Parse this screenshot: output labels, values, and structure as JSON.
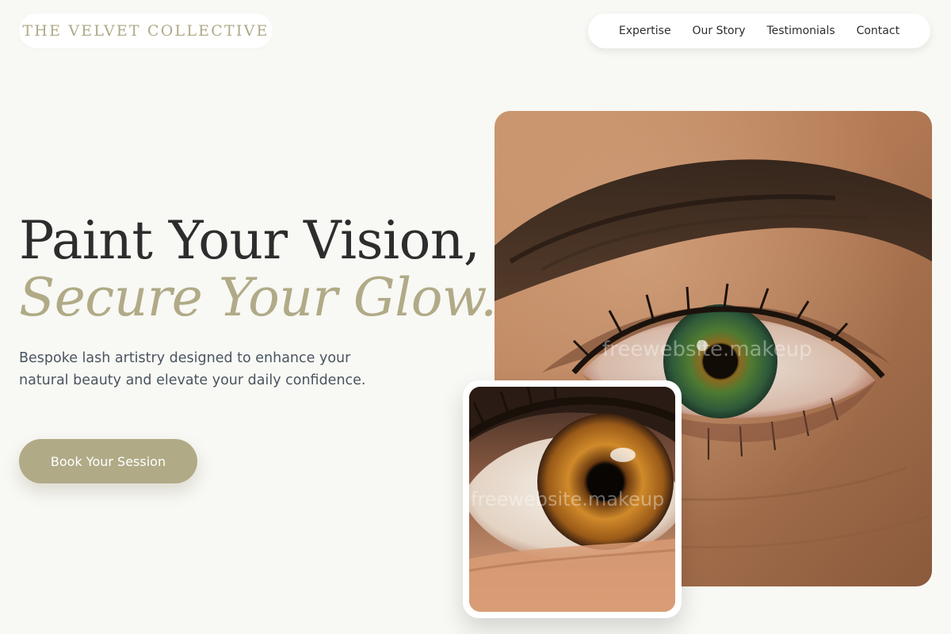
{
  "brand": {
    "name": "THE VELVET COLLECTIVE"
  },
  "nav": {
    "items": [
      {
        "label": "Expertise"
      },
      {
        "label": "Our Story"
      },
      {
        "label": "Testimonials"
      },
      {
        "label": "Contact"
      }
    ]
  },
  "hero": {
    "title_line1": "Paint Your Vision,",
    "title_line2": "Secure Your Glow.",
    "description": "Bespoke lash artistry designed to enhance your natural beauty and elevate your daily confidence.",
    "cta_label": "Book Your Session"
  },
  "images": {
    "main": {
      "watermark": "freewebsite.makeup"
    },
    "inset": {
      "watermark": "freewebsite.makeup"
    }
  },
  "colors": {
    "accent": "#b0aa87",
    "background": "#f8f8f4",
    "heading": "#2d2d2d",
    "body_text": "#4a5560"
  },
  "icons": [
    "eye-closeup-photo",
    "amber-eye-photo"
  ]
}
